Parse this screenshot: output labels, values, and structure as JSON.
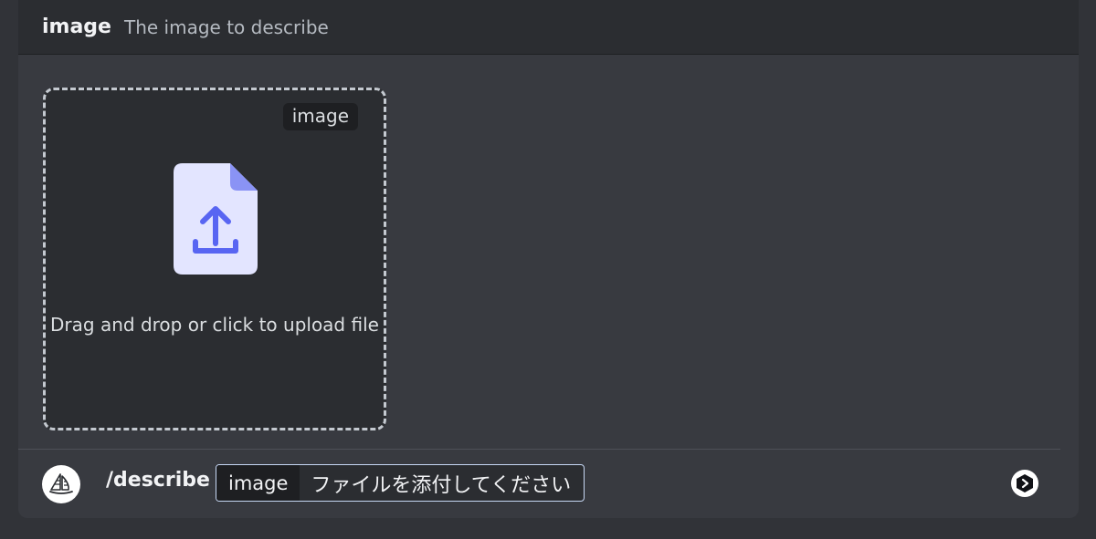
{
  "option_header": {
    "name": "image",
    "description": "The image to describe"
  },
  "dropzone": {
    "tag": "image",
    "text": "Drag and drop or click to upload file",
    "icon": "file-upload-icon"
  },
  "command_bar": {
    "avatar_icon": "sailboat-icon",
    "command": "/describe",
    "param_name": "image",
    "param_value": "ファイルを添付してください",
    "app_icon": "app-badge-icon"
  },
  "colors": {
    "background": "#313338",
    "panel": "#383a40",
    "header": "#2b2d31",
    "file_icon_fill": "#e3e5ff",
    "file_icon_accent": "#5865f2",
    "input_border": "#c7d8f5"
  }
}
